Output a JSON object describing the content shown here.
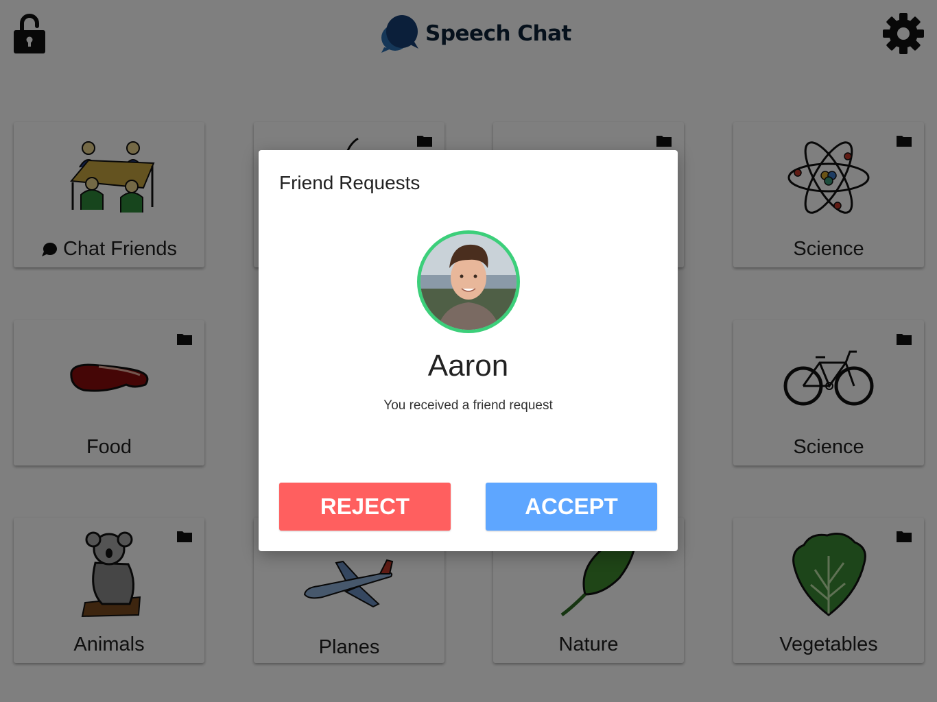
{
  "app": {
    "title": "Speech Chat",
    "icons": {
      "lock": "unlocked-padlock-icon",
      "settings": "gear-icon",
      "logo": "chat-bubbles-icon"
    }
  },
  "tiles": [
    {
      "label": "Chat Friends",
      "icon": "people-at-table-icon",
      "folder": false,
      "chat_badge": true
    },
    {
      "label": "",
      "icon": "apple-icon",
      "folder": true
    },
    {
      "label": "",
      "icon": "unknown-icon",
      "folder": true
    },
    {
      "label": "Science",
      "icon": "atom-icon",
      "folder": true
    },
    {
      "label": "Food",
      "icon": "steak-icon",
      "folder": true
    },
    {
      "label": "Science",
      "icon": "bicycle-icon",
      "folder": true
    },
    {
      "label": "Animals",
      "icon": "koala-icon",
      "folder": true
    },
    {
      "label": "Planes",
      "icon": "airplane-icon",
      "folder": false
    },
    {
      "label": "Nature",
      "icon": "leaf-icon",
      "folder": false
    },
    {
      "label": "Vegetables",
      "icon": "lettuce-icon",
      "folder": true
    }
  ],
  "dialog": {
    "title": "Friend Requests",
    "name": "Aaron",
    "message": "You received a friend request",
    "reject_label": "REJECT",
    "accept_label": "ACCEPT",
    "colors": {
      "reject": "#ff5f5f",
      "accept": "#5ea6ff",
      "avatar_ring": "#3ccf7a"
    }
  }
}
